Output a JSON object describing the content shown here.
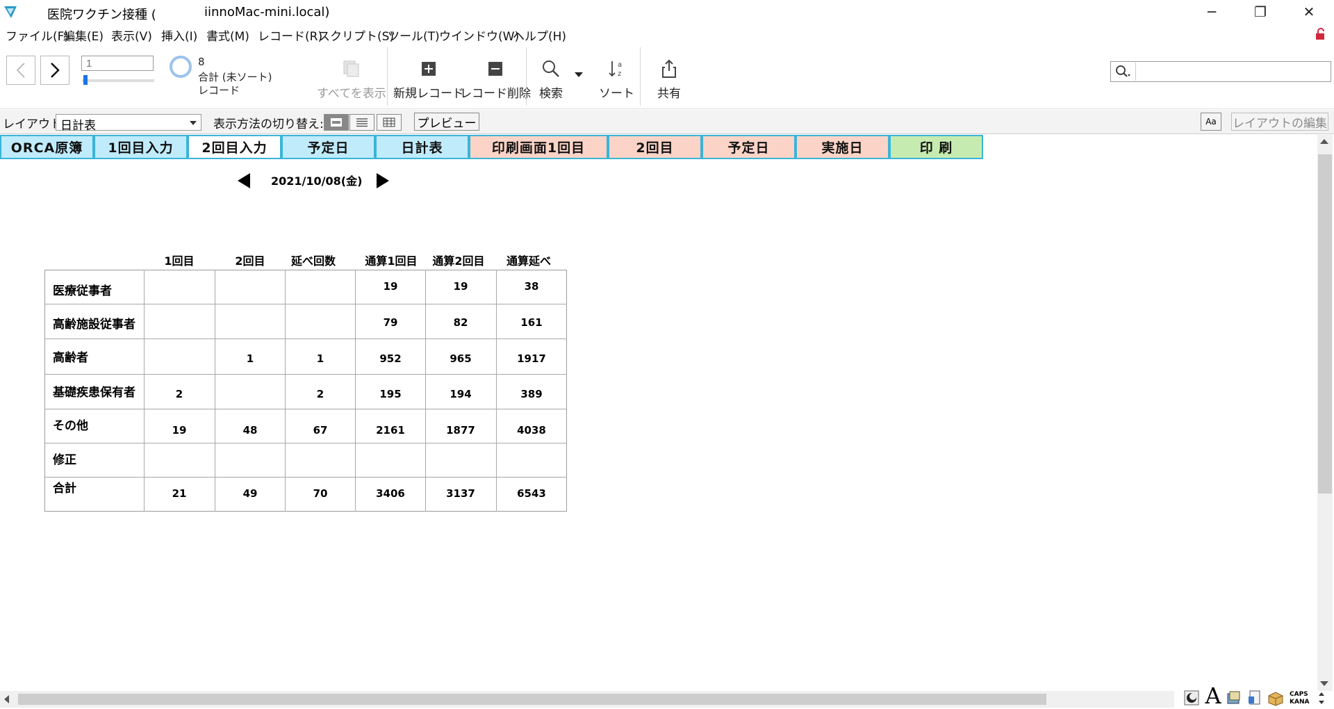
{
  "window": {
    "title": "医院ワクチン接種 (",
    "host": "iinnoMac-mini.local)",
    "minimize": "─",
    "restore": "❐",
    "close": "✕"
  },
  "menu": [
    "ファイル(F)",
    "編集(E)",
    "表示(V)",
    "挿入(I)",
    "書式(M)",
    "レコード(R)",
    "スクリプト(S)",
    "ツール(T)",
    "ウインドウ(W)",
    "ヘルプ(H)"
  ],
  "toolbar": {
    "record_value": "1",
    "record_count": "8",
    "record_status": "合計 (未ソート)",
    "record_label": "レコード",
    "show_all": "すべてを表示",
    "new_record": "新規レコード",
    "delete_record": "レコード削除",
    "find": "検索",
    "sort": "ソート",
    "share": "共有",
    "search_placeholder": ""
  },
  "layoutbar": {
    "layout_label": "レイアウト:",
    "layout_value": "日計表",
    "view_switch_label": "表示方法の切り替え:",
    "preview": "プレビュー",
    "aa": "Aa",
    "edit_layout": "レイアウトの編集"
  },
  "tabs": [
    {
      "label": "ORCA原簿",
      "color": "#c0ebfb"
    },
    {
      "label": "1回目入力",
      "color": "#c0ebfb"
    },
    {
      "label": "2回目入力",
      "color": "#ffffff"
    },
    {
      "label": "予定日",
      "color": "#c0ebfb"
    },
    {
      "label": "日計表",
      "color": "#c0ebfb"
    },
    {
      "label": "印刷画面1回目",
      "color": "#fbd4c7"
    },
    {
      "label": "2回目",
      "color": "#fbd4c7"
    },
    {
      "label": "予定日",
      "color": "#fbd4c7"
    },
    {
      "label": "実施日",
      "color": "#fbd4c7"
    },
    {
      "label": "印 刷",
      "color": "#c6ebb0"
    }
  ],
  "date": "2021/10/08(金)",
  "table": {
    "columns": [
      "1回目",
      "2回目",
      "延べ回数",
      "通算1回目",
      "通算2回目",
      "通算延べ"
    ],
    "rows": [
      {
        "label": "医療従事者",
        "values": [
          "",
          "",
          "",
          "19",
          "19",
          "38"
        ]
      },
      {
        "label": "高齢施設従事者",
        "values": [
          "",
          "",
          "",
          "79",
          "82",
          "161"
        ]
      },
      {
        "label": "高齢者",
        "values": [
          "",
          "1",
          "1",
          "952",
          "965",
          "1917"
        ]
      },
      {
        "label": "基礎疾患保有者",
        "values": [
          "2",
          "",
          "2",
          "195",
          "194",
          "389"
        ]
      },
      {
        "label": "その他",
        "values": [
          "19",
          "48",
          "67",
          "2161",
          "1877",
          "4038"
        ]
      },
      {
        "label": "修正",
        "values": [
          "",
          "",
          "",
          "",
          "",
          ""
        ]
      },
      {
        "label": "合計",
        "values": [
          "21",
          "49",
          "70",
          "3406",
          "3137",
          "6543"
        ]
      }
    ]
  },
  "status": {
    "caps": "CAPS",
    "kana": "KANA"
  }
}
